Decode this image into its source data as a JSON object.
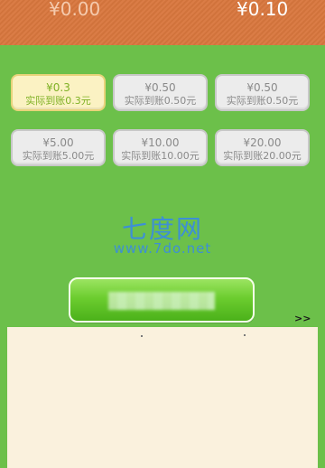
{
  "balances": {
    "left": "¥0.00",
    "right": "¥0.10"
  },
  "options": [
    {
      "amount": "¥0.3",
      "actual": "实际到账0.3元",
      "selected": true
    },
    {
      "amount": "¥0.50",
      "actual": "实际到账0.50元",
      "selected": false
    },
    {
      "amount": "¥0.50",
      "actual": "实际到账0.50元",
      "selected": false
    },
    {
      "amount": "¥5.00",
      "actual": "实际到账5.00元",
      "selected": false
    },
    {
      "amount": "¥10.00",
      "actual": "实际到账10.00元",
      "selected": false
    },
    {
      "amount": "¥20.00",
      "actual": "实际到账20.00元",
      "selected": false
    }
  ],
  "watermark": {
    "title": "七度网",
    "url": "www.7do.net"
  },
  "more_label": ">>",
  "colors": {
    "background": "#6cc04a",
    "topbar": "#d8773e",
    "selected_text": "#7fb125",
    "panel": "#faf1dd"
  }
}
